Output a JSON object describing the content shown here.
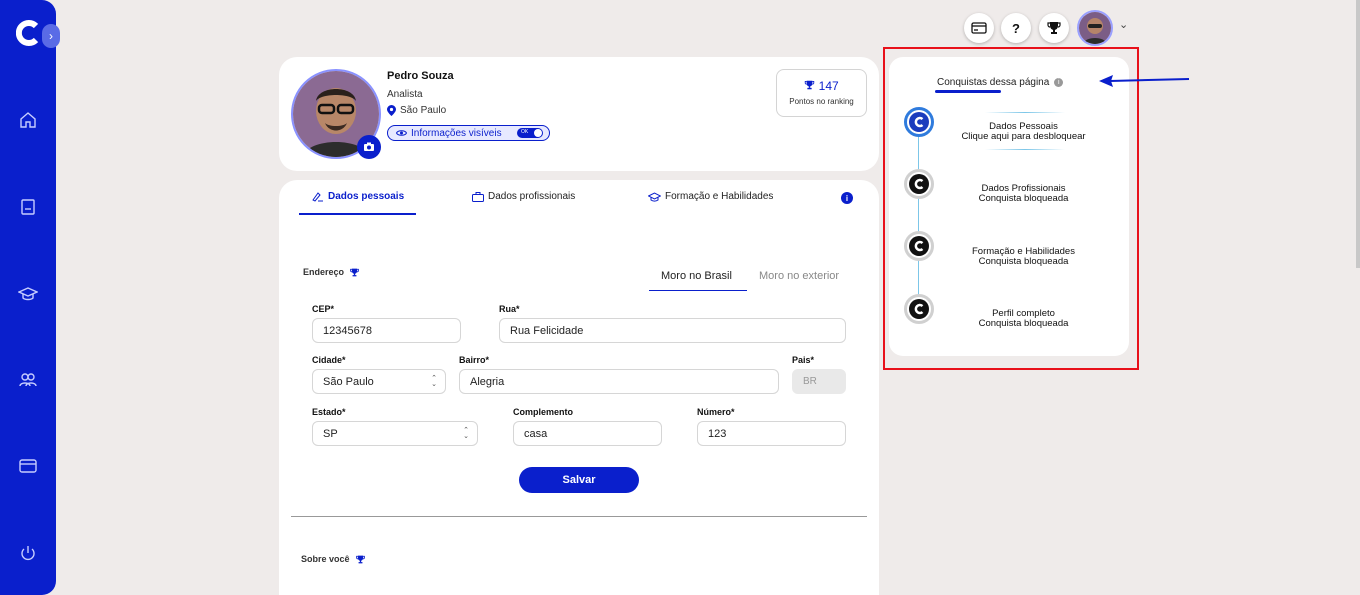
{
  "sidebar": {
    "expand_icon": "chevron-right-icon",
    "items": [
      {
        "name": "home",
        "icon": "home-icon"
      },
      {
        "name": "document",
        "icon": "document-icon"
      },
      {
        "name": "education",
        "icon": "graduation-cap-icon"
      },
      {
        "name": "people",
        "icon": "users-icon"
      },
      {
        "name": "card",
        "icon": "credit-card-icon"
      },
      {
        "name": "logout",
        "icon": "power-icon"
      }
    ]
  },
  "topbar": {
    "help_label": "?",
    "icons": [
      "credit-card-icon",
      "help-icon",
      "trophy-icon",
      "avatar",
      "chevron-down-icon"
    ]
  },
  "profile": {
    "name": "Pedro Souza",
    "role": "Analista",
    "city": "São Paulo",
    "visibility_label": "Informações visíveis",
    "toggle_label": "OK",
    "ranking_points": "147",
    "ranking_label": "Pontos no ranking"
  },
  "tabs": [
    {
      "label": "Dados pessoais",
      "active": true
    },
    {
      "label": "Dados profissionais",
      "active": false
    },
    {
      "label": "Formação e Habilidades",
      "active": false
    }
  ],
  "address": {
    "section_label": "Endereço",
    "location_tabs": {
      "brazil": "Moro no Brasil",
      "abroad": "Moro no exterior"
    },
    "fields": {
      "cep": {
        "label": "CEP*",
        "value": "12345678"
      },
      "rua": {
        "label": "Rua*",
        "value": "Rua Felicidade"
      },
      "cidade": {
        "label": "Cidade*",
        "value": "São Paulo"
      },
      "bairro": {
        "label": "Bairro*",
        "value": "Alegria"
      },
      "pais": {
        "label": "Pais*",
        "value": "BR"
      },
      "estado": {
        "label": "Estado*",
        "value": "SP"
      },
      "complemento": {
        "label": "Complemento",
        "value": "casa"
      },
      "numero": {
        "label": "Número*",
        "value": "123"
      }
    },
    "save_label": "Salvar"
  },
  "about": {
    "section_label": "Sobre você"
  },
  "achievements": {
    "title": "Conquistas dessa página",
    "items": [
      {
        "title": "Dados Pessoais",
        "status": "Clique aqui para desbloquear",
        "unlocked": true
      },
      {
        "title": "Dados Profissionais",
        "status": "Conquista bloqueada",
        "unlocked": false
      },
      {
        "title": "Formação e Habilidades",
        "status": "Conquista bloqueada",
        "unlocked": false
      },
      {
        "title": "Perfil completo",
        "status": "Conquista bloqueada",
        "unlocked": false
      }
    ]
  },
  "colors": {
    "brand": "#0a1fcc",
    "highlight": "#e8101a",
    "timeline": "#7cc6e8"
  }
}
